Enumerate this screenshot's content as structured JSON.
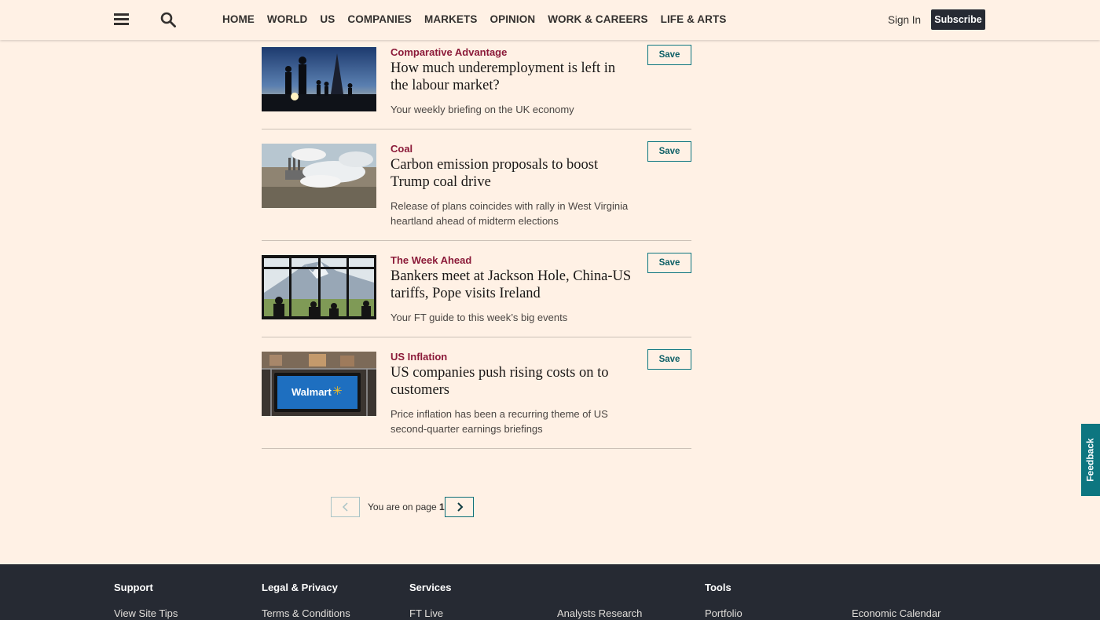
{
  "header": {
    "nav": [
      "HOME",
      "WORLD",
      "US",
      "COMPANIES",
      "MARKETS",
      "OPINION",
      "WORK & CAREERS",
      "LIFE & ARTS"
    ],
    "sign_in": "Sign In",
    "subscribe": "Subscribe"
  },
  "articles": [
    {
      "tag": "Comparative Advantage",
      "headline": "How much underemployment is left in the labour market?",
      "standfirst": "Your weekly briefing on the UK economy",
      "save": "Save"
    },
    {
      "tag": "Coal",
      "headline": "Carbon emission proposals to boost Trump coal drive",
      "standfirst": "Release of plans coincides with rally in West Virginia heartland ahead of midterm elections",
      "save": "Save"
    },
    {
      "tag": "The Week Ahead",
      "headline": "Bankers meet at Jackson Hole, China-US tariffs, Pope visits Ireland",
      "standfirst": "Your FT guide to this week’s big events",
      "save": "Save"
    },
    {
      "tag": "US Inflation",
      "headline": "US companies push rising costs on to customers",
      "standfirst": "Price inflation has been a recurring theme of US second-quarter earnings briefings",
      "save": "Save",
      "image_text": "Walmart"
    }
  ],
  "pagination": {
    "text": "You are on page",
    "page": "1"
  },
  "feedback": "Feedback",
  "footer": {
    "columns": [
      {
        "heading": "Support",
        "link": "View Site Tips"
      },
      {
        "heading": "Legal & Privacy",
        "link": "Terms & Conditions"
      },
      {
        "heading": "Services",
        "link": "FT Live"
      },
      {
        "heading": "",
        "link": "Analysts Research"
      },
      {
        "heading": "Tools",
        "link": "Portfolio"
      },
      {
        "heading": "",
        "link": "Economic Calendar"
      }
    ]
  },
  "colors": {
    "background": "#fff1e5",
    "tag": "#8b1a39",
    "accent_teal": "#0d7680",
    "footer": "#262a33"
  }
}
